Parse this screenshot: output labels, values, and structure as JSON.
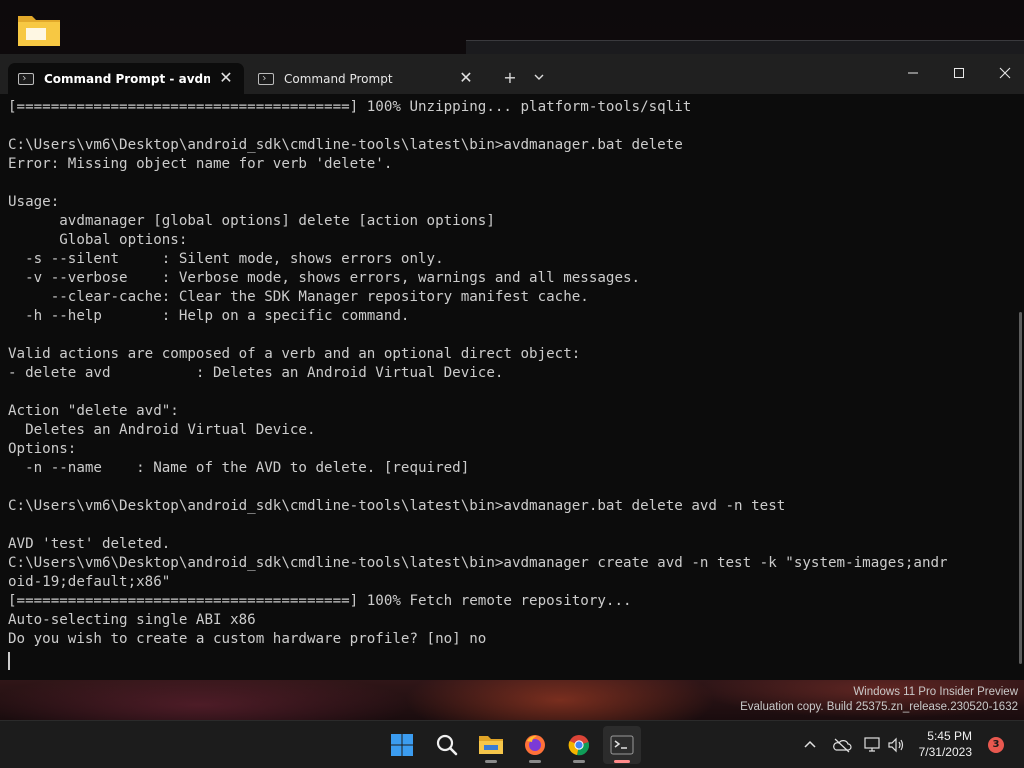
{
  "window": {
    "tabs": [
      {
        "label": "Command Prompt - avdmana",
        "active": true
      },
      {
        "label": "Command Prompt",
        "active": false
      }
    ],
    "new_tab_label": "+",
    "dropdown_icon": "chevron-down-icon"
  },
  "console": {
    "lines": [
      "[=======================================] 100% Unzipping... platform-tools/sqlit",
      "",
      "C:\\Users\\vm6\\Desktop\\android_sdk\\cmdline-tools\\latest\\bin>avdmanager.bat delete",
      "Error: Missing object name for verb 'delete'.",
      "",
      "Usage:",
      "      avdmanager [global options] delete [action options]",
      "      Global options:",
      "  -s --silent     : Silent mode, shows errors only.",
      "  -v --verbose    : Verbose mode, shows errors, warnings and all messages.",
      "     --clear-cache: Clear the SDK Manager repository manifest cache.",
      "  -h --help       : Help on a specific command.",
      "",
      "Valid actions are composed of a verb and an optional direct object:",
      "- delete avd          : Deletes an Android Virtual Device.",
      "",
      "Action \"delete avd\":",
      "  Deletes an Android Virtual Device.",
      "Options:",
      "  -n --name    : Name of the AVD to delete. [required]",
      "",
      "C:\\Users\\vm6\\Desktop\\android_sdk\\cmdline-tools\\latest\\bin>avdmanager.bat delete avd -n test",
      "",
      "AVD 'test' deleted.",
      "C:\\Users\\vm6\\Desktop\\android_sdk\\cmdline-tools\\latest\\bin>avdmanager create avd -n test -k \"system-images;andr",
      "oid-19;default;x86\"",
      "[=======================================] 100% Fetch remote repository...",
      "Auto-selecting single ABI x86",
      "Do you wish to create a custom hardware profile? [no] no"
    ]
  },
  "watermark": {
    "line1": "Windows 11 Pro Insider Preview",
    "line2": "Evaluation copy. Build 25375.zn_release.230520-1632"
  },
  "taskbar": {
    "apps": [
      "start-icon",
      "search-icon",
      "file-explorer-icon",
      "firefox-icon",
      "chrome-icon",
      "terminal-icon"
    ],
    "time": "5:45 PM",
    "date": "7/31/2023",
    "notification_count": "3"
  },
  "colors": {
    "console_bg": "#0c0c0c",
    "console_text": "#cccccc",
    "titlebar_bg": "#202020",
    "taskbar_bg": "#1c1c1c",
    "badge": "#e8584f"
  }
}
